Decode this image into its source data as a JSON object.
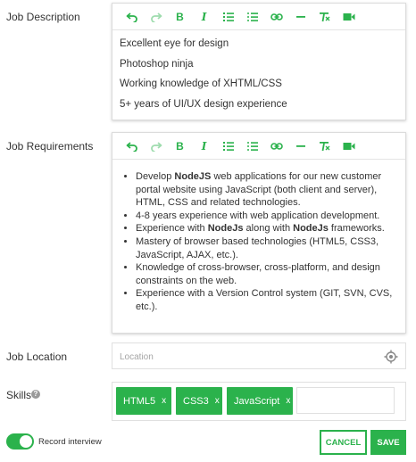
{
  "job_description": {
    "label": "Job Description",
    "lines": [
      "Excellent eye for design",
      "Photoshop ninja",
      "Working knowledge of XHTML/CSS",
      "5+ years of UI/UX design experience"
    ]
  },
  "job_requirements": {
    "label": "Job Requirements",
    "items": [
      [
        {
          "t": "Develop "
        },
        {
          "t": "NodeJS",
          "b": true
        },
        {
          "t": " web applications for our new customer portal website using JavaScript (both client and server), HTML, CSS and related technologies."
        }
      ],
      [
        {
          "t": "4-8 years experience with web application development."
        }
      ],
      [
        {
          "t": "Experience with "
        },
        {
          "t": "NodeJs",
          "b": true
        },
        {
          "t": " along with "
        },
        {
          "t": "NodeJs",
          "b": true
        },
        {
          "t": " frameworks."
        }
      ],
      [
        {
          "t": "Mastery of browser based technologies (HTML5, CSS3, JavaScript, AJAX, etc.)."
        }
      ],
      [
        {
          "t": "Knowledge of cross-browser, cross-platform, and design constraints on the web."
        }
      ],
      [
        {
          "t": "Experience with a Version Control system (GIT, SVN, CVS, etc.)."
        }
      ]
    ]
  },
  "toolbar": {
    "bold_glyph": "B",
    "italic_glyph": "I",
    "tools": [
      "undo-icon",
      "redo-icon",
      "bold-icon",
      "italic-icon",
      "ordered-list-icon",
      "bullet-list-icon",
      "link-icon",
      "horizontal-rule-icon",
      "clear-format-icon",
      "video-icon"
    ]
  },
  "job_location": {
    "label": "Job Location",
    "placeholder": "Location"
  },
  "skills": {
    "label": "Skills",
    "help_glyph": "?",
    "chips": [
      {
        "label": "HTML5",
        "remove": "x"
      },
      {
        "label": "CSS3",
        "remove": "x"
      },
      {
        "label": "JavaScript",
        "remove": "x"
      }
    ]
  },
  "record_interview": {
    "label": "Record interview",
    "enabled": true
  },
  "actions": {
    "cancel": "CANCEL",
    "save": "SAVE"
  },
  "colors": {
    "accent": "#2bb24c",
    "text": "#333333",
    "border": "#dcdcdc"
  }
}
